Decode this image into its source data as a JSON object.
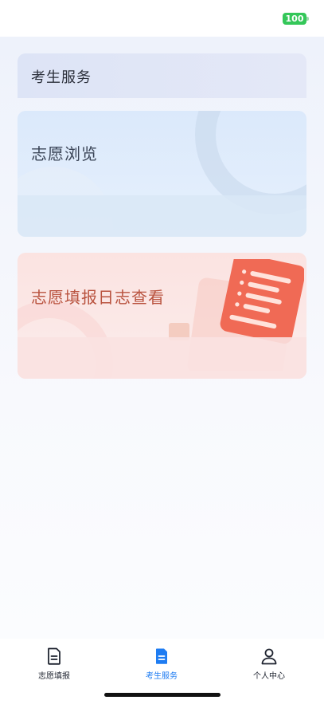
{
  "status_bar": {
    "battery": "100"
  },
  "header": {
    "title": "考生服务"
  },
  "cards": [
    {
      "title": "志愿浏览"
    },
    {
      "title": "志愿填报日志查看"
    }
  ],
  "tabbar": {
    "items": [
      {
        "label": "志愿填报",
        "icon": "document-icon",
        "active": false
      },
      {
        "label": "考生服务",
        "icon": "document-filled-icon",
        "active": true
      },
      {
        "label": "个人中心",
        "icon": "person-icon",
        "active": false
      }
    ]
  },
  "colors": {
    "accent": "#1e7cf2",
    "battery": "#34c759",
    "log_title": "#b9533f"
  }
}
